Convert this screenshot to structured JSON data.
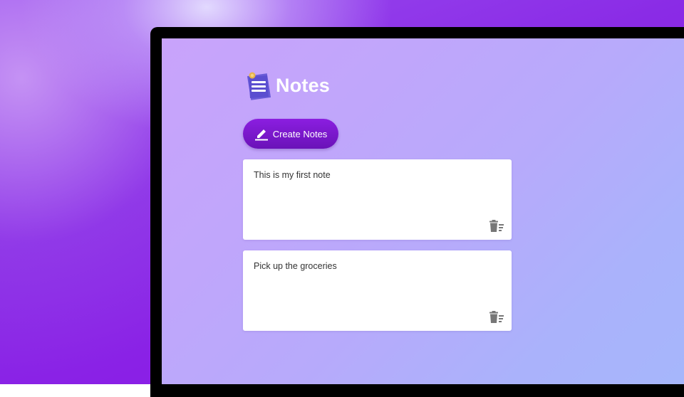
{
  "app": {
    "title": "Notes",
    "logo_icon": "notepad-icon"
  },
  "toolbar": {
    "create_label": "Create Notes",
    "create_icon": "pencil-icon"
  },
  "notes": [
    {
      "text": "This is my first note",
      "delete_icon": "trash-icon"
    },
    {
      "text": "Pick up the groceries",
      "delete_icon": "trash-icon"
    }
  ],
  "colors": {
    "button_gradient_top": "#8b1ee0",
    "button_gradient_bottom": "#6a12b8",
    "screen_gradient_start": "#c9a3fb",
    "screen_gradient_end": "#a6b6fb",
    "note_background": "#ffffff",
    "icon_gray": "#777777"
  }
}
